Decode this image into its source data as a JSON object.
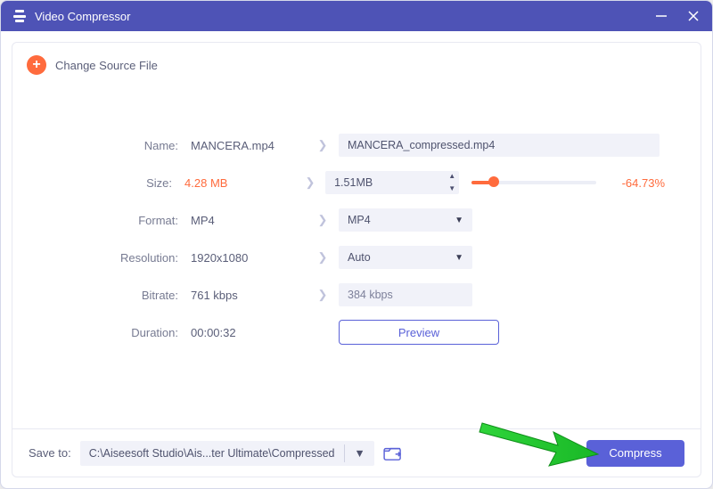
{
  "titlebar": {
    "title": "Video Compressor"
  },
  "source": {
    "change_label": "Change Source File"
  },
  "rows": {
    "name": {
      "label": "Name:",
      "src": "MANCERA.mp4",
      "dst": "MANCERA_compressed.mp4"
    },
    "size": {
      "label": "Size:",
      "src": "4.28 MB",
      "dst": "1.51MB",
      "pct": "-64.73%"
    },
    "format": {
      "label": "Format:",
      "src": "MP4",
      "dst": "MP4"
    },
    "resolution": {
      "label": "Resolution:",
      "src": "1920x1080",
      "dst": "Auto"
    },
    "bitrate": {
      "label": "Bitrate:",
      "src": "761 kbps",
      "dst": "384 kbps"
    },
    "duration": {
      "label": "Duration:",
      "src": "00:00:32"
    }
  },
  "buttons": {
    "preview": "Preview",
    "compress": "Compress"
  },
  "footer": {
    "save_label": "Save to:",
    "path": "C:\\Aiseesoft Studio\\Ais...ter Ultimate\\Compressed"
  },
  "colors": {
    "accent": "#ff6b3d",
    "primary": "#5a61d8",
    "titlebar": "#4e53b6"
  }
}
